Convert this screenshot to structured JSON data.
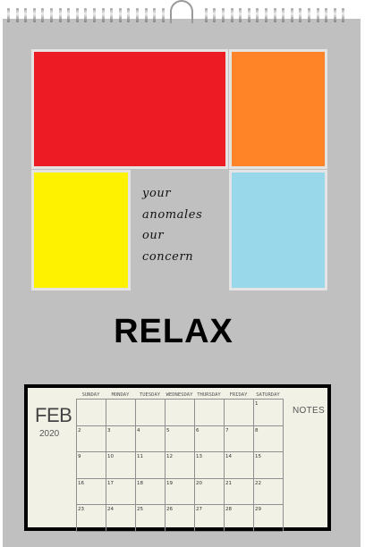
{
  "image": {
    "description": "Wall calendar mockup with color blocks"
  },
  "tagline": [
    "your",
    "anomales",
    "our",
    "concern"
  ],
  "headline": "RELAX",
  "calendar": {
    "month": "FEB",
    "year": "2020",
    "weekdays": [
      "SUNDAY",
      "MONDAY",
      "TUESDAY",
      "WEDNESDAY",
      "THURSDAY",
      "FRIDAY",
      "SATURDAY"
    ],
    "weeks": [
      [
        "",
        "",
        "",
        "",
        "",
        "",
        "1"
      ],
      [
        "2",
        "3",
        "4",
        "5",
        "6",
        "7",
        "8"
      ],
      [
        "9",
        "10",
        "11",
        "12",
        "13",
        "14",
        "15"
      ],
      [
        "16",
        "17",
        "18",
        "19",
        "20",
        "21",
        "22"
      ],
      [
        "23",
        "24",
        "25",
        "26",
        "27",
        "28",
        "29"
      ]
    ],
    "notes_label": "NOTES"
  },
  "colors": {
    "sheet": "#c0c0c0",
    "red": "#ed1c24",
    "orange": "#fe8427",
    "yellow": "#fef200",
    "blue": "#98d8ea",
    "calendar_bg": "#f1f1e6"
  }
}
